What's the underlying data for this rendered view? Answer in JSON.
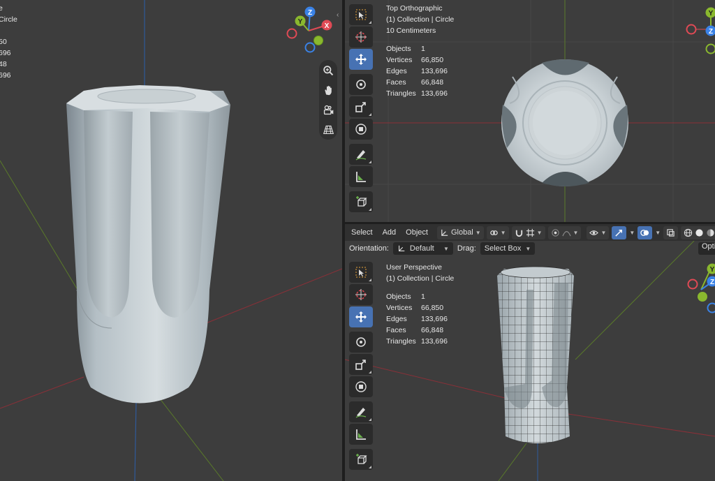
{
  "left_viewport": {
    "partial_lines": [
      "e",
      "Circle",
      "",
      "",
      "50",
      "696",
      "48",
      "696"
    ],
    "nav_icons": [
      "zoom-icon",
      "hand-pan-icon",
      "camera-icon",
      "grid-icon"
    ]
  },
  "top_right_viewport": {
    "view_name": "Top Orthographic",
    "collection": "(1) Collection | Circle",
    "scale": "10 Centimeters",
    "stats": [
      {
        "label": "Objects",
        "value": "1"
      },
      {
        "label": "Vertices",
        "value": "66,850"
      },
      {
        "label": "Edges",
        "value": "133,696"
      },
      {
        "label": "Faces",
        "value": "66,848"
      },
      {
        "label": "Triangles",
        "value": "133,696"
      }
    ],
    "gizmo": {
      "y": "Y",
      "z": "Z"
    }
  },
  "bottom_right_viewport": {
    "view_name": "User Perspective",
    "collection": "(1) Collection | Circle",
    "stats": [
      {
        "label": "Objects",
        "value": "1"
      },
      {
        "label": "Vertices",
        "value": "66,850"
      },
      {
        "label": "Edges",
        "value": "133,696"
      },
      {
        "label": "Faces",
        "value": "66,848"
      },
      {
        "label": "Triangles",
        "value": "133,696"
      }
    ],
    "gizmo": {
      "y": "Y",
      "z": "Z"
    }
  },
  "gizmo_left": {
    "x": "X",
    "y": "Y",
    "z": "Z"
  },
  "header": {
    "menus": [
      "Select",
      "Add",
      "Object"
    ],
    "transform_orientation": "Global"
  },
  "subheader": {
    "orientation_label": "Orientation:",
    "orientation_value": "Default",
    "drag_label": "Drag:",
    "drag_value": "Select Box",
    "options_label": "Opti"
  },
  "colors": {
    "viewport_bg": "#3d3d3d",
    "accent": "#4772b3",
    "axis_x": "#e04a55",
    "axis_y": "#8ab82e",
    "axis_z": "#3a82e6"
  }
}
